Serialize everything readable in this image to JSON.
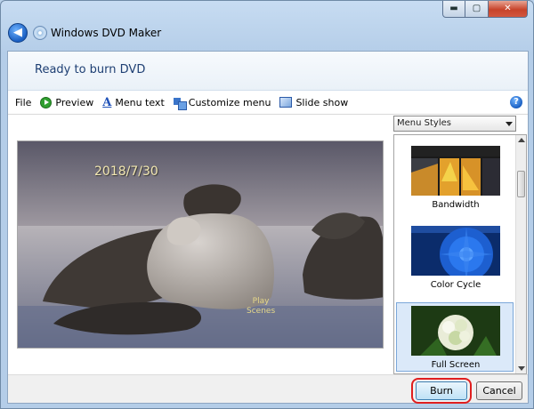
{
  "window": {
    "title": "Windows DVD Maker",
    "controls": {
      "minimize": "▬",
      "maximize": "▢",
      "close": "✕"
    }
  },
  "header": {
    "title": "Ready to burn DVD"
  },
  "toolbar": {
    "items": [
      {
        "label": "File"
      },
      {
        "label": "Preview",
        "icon": "play-icon"
      },
      {
        "label": "Menu text",
        "icon": "text-a-icon"
      },
      {
        "label": "Customize menu",
        "icon": "customize-icon"
      },
      {
        "label": "Slide show",
        "icon": "slideshow-icon"
      }
    ],
    "help": "?"
  },
  "preview": {
    "date_text": "2018/7/30",
    "menu_line1": "Play",
    "menu_line2": "Scenes"
  },
  "menu_styles": {
    "dropdown_value": "Menu Styles",
    "items": [
      {
        "label": "Bandwidth",
        "selected": false
      },
      {
        "label": "Color Cycle",
        "selected": false
      },
      {
        "label": "Full Screen",
        "selected": true
      }
    ]
  },
  "footer": {
    "burn_label": "Burn",
    "cancel_label": "Cancel"
  }
}
